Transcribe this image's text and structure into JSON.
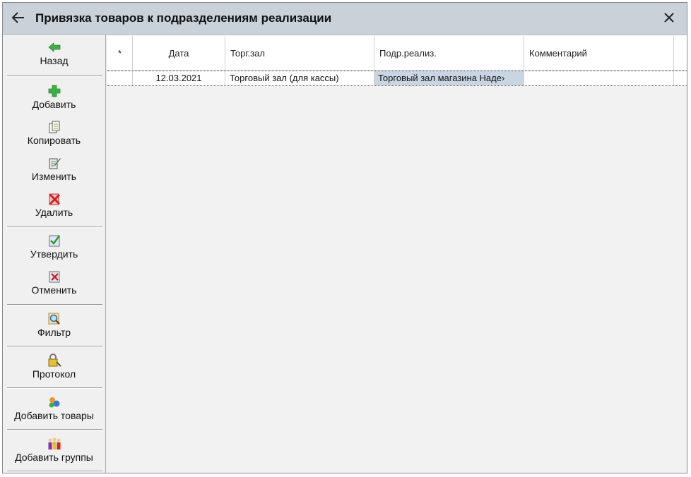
{
  "window": {
    "title": "Привязка товаров к подразделениям реализации"
  },
  "toolbar": {
    "back": "Назад",
    "add": "Добавить",
    "copy": "Копировать",
    "edit": "Изменить",
    "delete": "Удалить",
    "approve": "Утвердить",
    "cancel": "Отменить",
    "filter": "Фильтр",
    "protocol": "Протокол",
    "add_goods": "Добавить товары",
    "add_groups": "Добавить группы"
  },
  "table": {
    "columns": [
      "*",
      "Дата",
      "Торг.зал",
      "Подр.реализ.",
      "Комментарий"
    ],
    "rows": [
      {
        "marker": "",
        "date": "12.03.2021",
        "hall": "Торговый зал (для кассы)",
        "unit": "Торговый зал магазина Наде›",
        "comment": ""
      }
    ]
  },
  "colors": {
    "titlebar": "#c9d2d9",
    "selected_cell": "#c8d6e4",
    "add_icon": "#3cb043",
    "delete_icon": "#d42020"
  }
}
